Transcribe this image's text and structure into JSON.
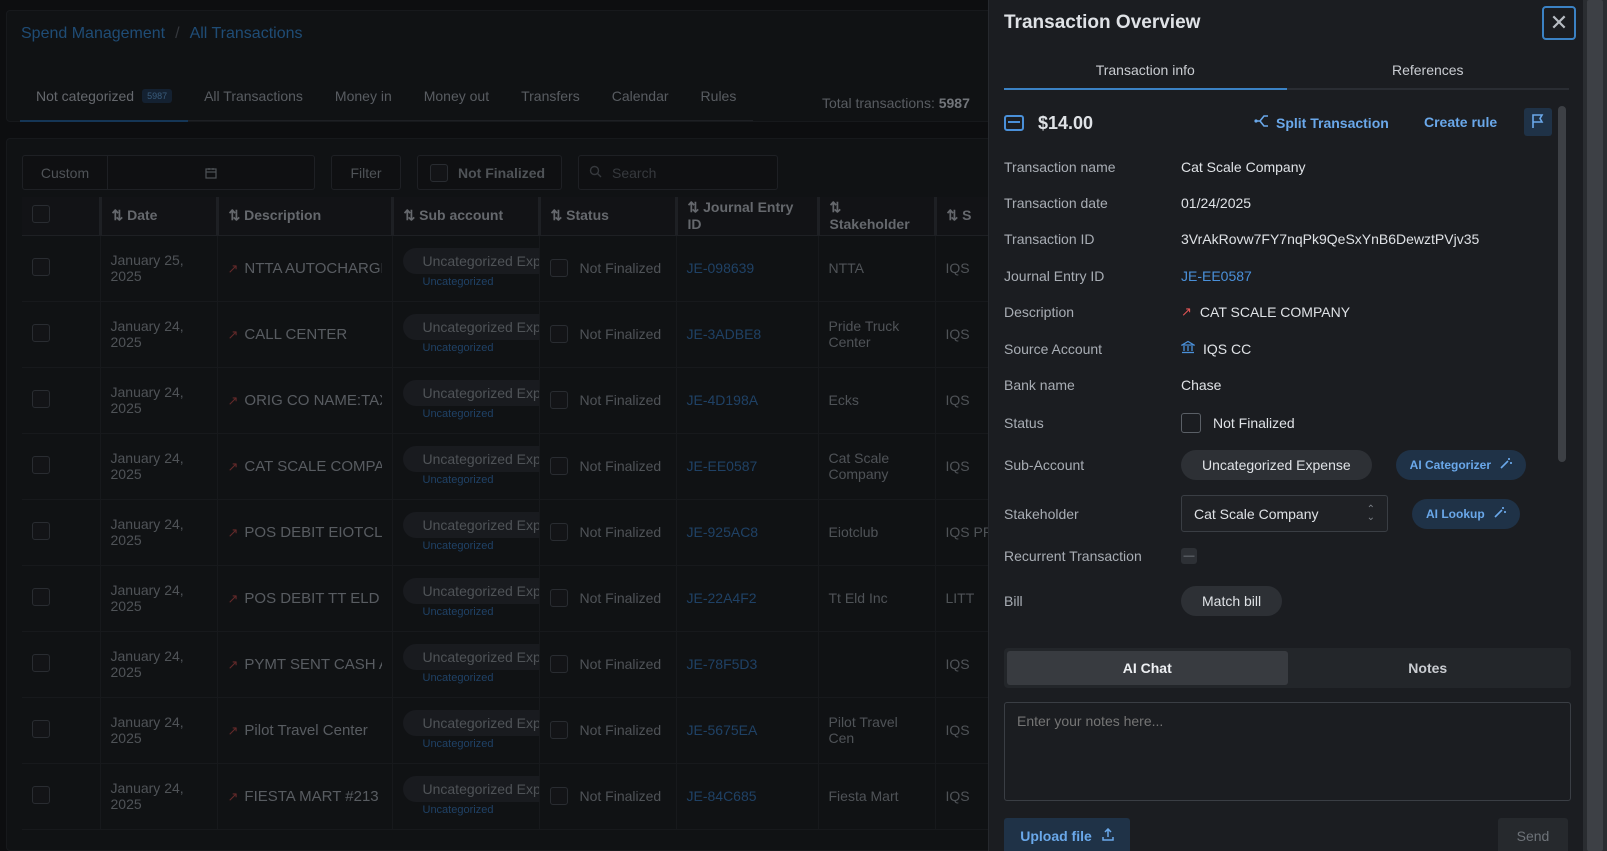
{
  "breadcrumb": {
    "root": "Spend Management",
    "separator": "/",
    "current": "All Transactions"
  },
  "main_tabs": [
    {
      "label": "Not categorized",
      "count": "5987"
    },
    {
      "label": "All Transactions"
    },
    {
      "label": "Money in"
    },
    {
      "label": "Money out"
    },
    {
      "label": "Transfers"
    },
    {
      "label": "Calendar"
    },
    {
      "label": "Rules"
    }
  ],
  "total": {
    "label": "Total transactions:",
    "value": "5987"
  },
  "filters": {
    "custom": "Custom",
    "filter": "Filter",
    "not_finalized": "Not Finalized",
    "search_placeholder": "Search"
  },
  "columns": [
    "Date",
    "Description",
    "Sub account",
    "Status",
    "Journal Entry ID",
    "Stakeholder",
    "S"
  ],
  "rows": [
    {
      "date": "January 25, 2025",
      "desc": "NTTA AUTOCHARGE",
      "sub": "Uncategorized Expe",
      "sub2": "Uncategorized",
      "status": "Not Finalized",
      "je": "JE-098639",
      "stake": "NTTA",
      "src": "IQS"
    },
    {
      "date": "January 24, 2025",
      "desc": "CALL CENTER",
      "sub": "Uncategorized Expe",
      "sub2": "Uncategorized",
      "status": "Not Finalized",
      "je": "JE-3ADBE8",
      "stake": "Pride Truck Center",
      "src": "IQS"
    },
    {
      "date": "January 24, 2025",
      "desc": "ORIG CO NAME:TAX_",
      "sub": "Uncategorized Expe",
      "sub2": "Uncategorized",
      "status": "Not Finalized",
      "je": "JE-4D198A",
      "stake": "Ecks",
      "src": "IQS"
    },
    {
      "date": "January 24, 2025",
      "desc": "CAT SCALE COMPANY",
      "sub": "Uncategorized Expe",
      "sub2": "Uncategorized",
      "status": "Not Finalized",
      "je": "JE-EE0587",
      "stake": "Cat Scale Company",
      "src": "IQS"
    },
    {
      "date": "January 24, 2025",
      "desc": "POS DEBIT EIOTCLUB",
      "sub": "Uncategorized Expe",
      "sub2": "Uncategorized",
      "status": "Not Finalized",
      "je": "JE-925AC8",
      "stake": "Eiotclub",
      "src": "IQS PRC"
    },
    {
      "date": "January 24, 2025",
      "desc": "POS DEBIT TT ELD IN",
      "sub": "Uncategorized Expe",
      "sub2": "Uncategorized",
      "status": "Not Finalized",
      "je": "JE-22A4F2",
      "stake": "Tt Eld Inc",
      "src": "LITT"
    },
    {
      "date": "January 24, 2025",
      "desc": "PYMT SENT CASH AP",
      "sub": "Uncategorized Expe",
      "sub2": "Uncategorized",
      "status": "Not Finalized",
      "je": "JE-78F5D3",
      "stake": "",
      "src": "IQS"
    },
    {
      "date": "January 24, 2025",
      "desc": "Pilot Travel Center",
      "sub": "Uncategorized Expe",
      "sub2": "Uncategorized",
      "status": "Not Finalized",
      "je": "JE-5675EA",
      "stake": "Pilot Travel Cen",
      "src": "IQS"
    },
    {
      "date": "January 24, 2025",
      "desc": "FIESTA MART #213",
      "sub": "Uncategorized Expe",
      "sub2": "Uncategorized",
      "status": "Not Finalized",
      "je": "JE-84C685",
      "stake": "Fiesta Mart",
      "src": "IQS"
    }
  ],
  "drawer": {
    "title": "Transaction Overview",
    "tabs": [
      "Transaction info",
      "References"
    ],
    "amount": "$14.00",
    "split_label": "Split Transaction",
    "rule_label": "Create rule",
    "fields": {
      "name": {
        "label": "Transaction name",
        "value": "Cat Scale Company"
      },
      "date": {
        "label": "Transaction date",
        "value": "01/24/2025"
      },
      "id": {
        "label": "Transaction ID",
        "value": "3VrAkRovw7FY7nqPk9QeSxYnB6DewztPVjv35"
      },
      "je": {
        "label": "Journal Entry ID",
        "value": "JE-EE0587"
      },
      "desc": {
        "label": "Description",
        "value": "CAT SCALE COMPANY"
      },
      "source": {
        "label": "Source Account",
        "value": "IQS CC"
      },
      "bank": {
        "label": "Bank name",
        "value": "Chase"
      },
      "status": {
        "label": "Status",
        "value": "Not Finalized"
      },
      "subaccount": {
        "label": "Sub-Account",
        "value": "Uncategorized Expense",
        "ai": "AI Categorizer"
      },
      "stakeholder": {
        "label": "Stakeholder",
        "value": "Cat Scale Company",
        "ai": "AI Lookup"
      },
      "recurrent": {
        "label": "Recurrent Transaction"
      },
      "bill": {
        "label": "Bill",
        "value": "Match bill"
      }
    },
    "chat_tabs": [
      "AI Chat",
      "Notes"
    ],
    "notes_placeholder": "Enter your notes here...",
    "upload_label": "Upload file",
    "send_label": "Send"
  }
}
